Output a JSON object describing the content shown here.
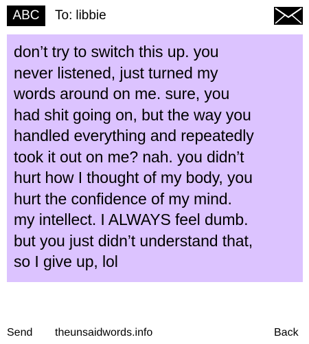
{
  "header": {
    "mode_badge": "ABC",
    "to_label": "To:",
    "recipient": "libbie",
    "envelope_icon": "envelope-icon"
  },
  "message": {
    "text": "don’t try to switch this up. you\nnever listened, just turned my\nwords around on me. sure, you\nhad shit going on, but the way you\nhandled everything and repeatedly\ntook it out on me? nah. you didn’t\nhurt how I thought of my body, you\nhurt the confidence of my mind.\nmy intellect. I ALWAYS feel dumb.\nbut you just didn’t understand that,\nso I give up, lol",
    "highlight_color": "#dcc3ff"
  },
  "footer": {
    "send_label": "Send",
    "site": "theunsaidwords.info",
    "back_label": "Back"
  }
}
